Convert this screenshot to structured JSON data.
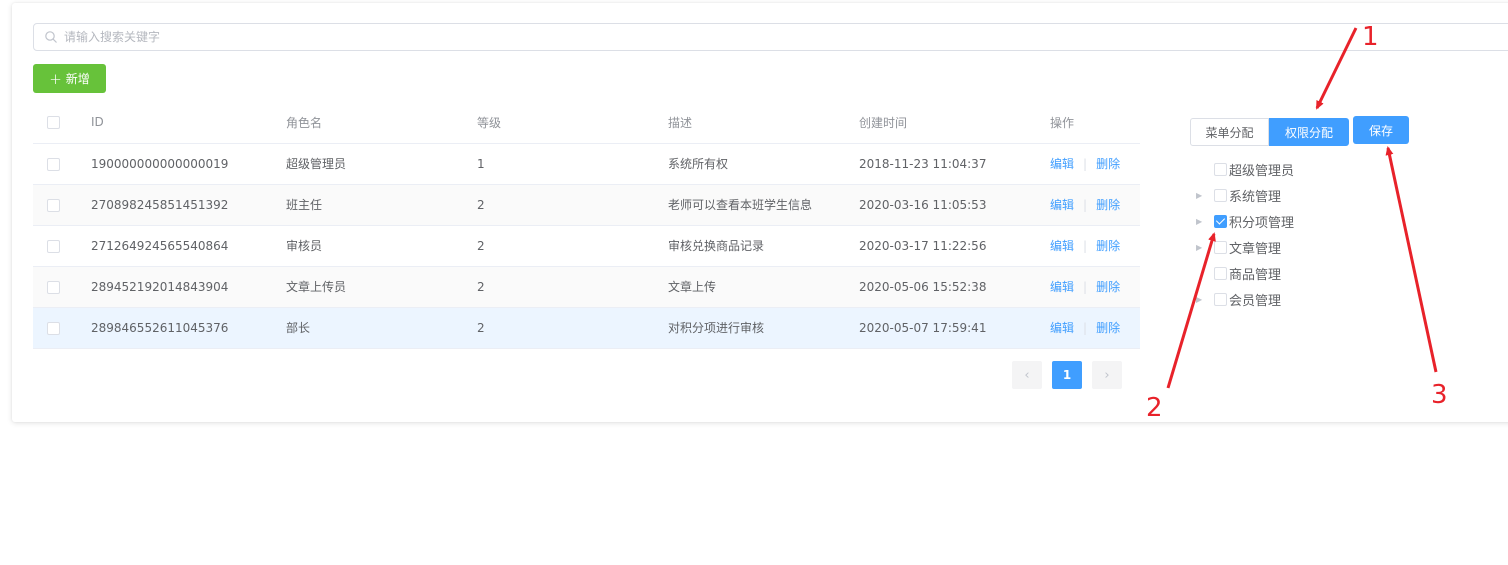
{
  "search": {
    "placeholder": "请输入搜索关键字"
  },
  "toolbar": {
    "add_label": "新增"
  },
  "table": {
    "headers": {
      "id": "ID",
      "name": "角色名",
      "level": "等级",
      "desc": "描述",
      "created": "创建时间",
      "ops": "操作"
    },
    "rows": [
      {
        "id": "190000000000000019",
        "name": "超级管理员",
        "level": "1",
        "desc": "系统所有权",
        "created": "2018-11-23 11:04:37"
      },
      {
        "id": "270898245851451392",
        "name": "班主任",
        "level": "2",
        "desc": "老师可以查看本班学生信息",
        "created": "2020-03-16 11:05:53"
      },
      {
        "id": "271264924565540864",
        "name": "审核员",
        "level": "2",
        "desc": "审核兑换商品记录",
        "created": "2020-03-17 11:22:56"
      },
      {
        "id": "289452192014843904",
        "name": "文章上传员",
        "level": "2",
        "desc": "文章上传",
        "created": "2020-05-06 15:52:38"
      },
      {
        "id": "289846552611045376",
        "name": "部长",
        "level": "2",
        "desc": "对积分项进行审核",
        "created": "2020-05-07 17:59:41"
      }
    ],
    "edit_label": "编辑",
    "delete_label": "删除",
    "divider": "|"
  },
  "pagination": {
    "current_page": "1",
    "prev_glyph": "‹",
    "next_glyph": "›"
  },
  "permission_panel": {
    "tab_menu": "菜单分配",
    "tab_permission": "权限分配",
    "active_tab": "权限分配",
    "save_label": "保存",
    "tree": [
      {
        "label": "超级管理员",
        "checked": false,
        "expandable": false
      },
      {
        "label": "系统管理",
        "checked": false,
        "expandable": true
      },
      {
        "label": "积分项管理",
        "checked": true,
        "expandable": true
      },
      {
        "label": "文章管理",
        "checked": false,
        "expandable": true
      },
      {
        "label": "商品管理",
        "checked": false,
        "expandable": false
      },
      {
        "label": "会员管理",
        "checked": false,
        "expandable": true
      }
    ]
  },
  "annotations": {
    "n1": "1",
    "n2": "2",
    "n3": "3"
  },
  "colors": {
    "primary": "#409eff",
    "success": "#67c23a",
    "annotation": "#e8222a"
  }
}
